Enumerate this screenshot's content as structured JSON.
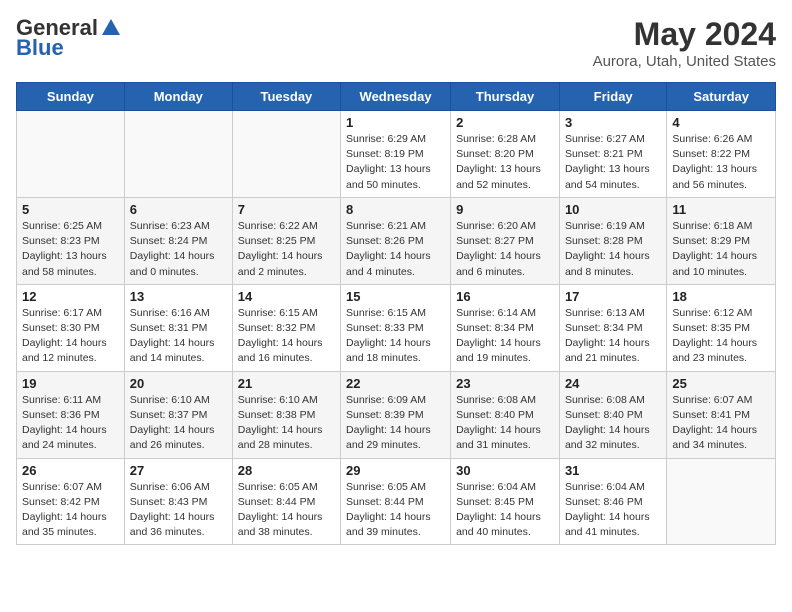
{
  "header": {
    "logo_general": "General",
    "logo_blue": "Blue",
    "month_title": "May 2024",
    "location": "Aurora, Utah, United States"
  },
  "weekdays": [
    "Sunday",
    "Monday",
    "Tuesday",
    "Wednesday",
    "Thursday",
    "Friday",
    "Saturday"
  ],
  "weeks": [
    [
      {
        "day": "",
        "info": ""
      },
      {
        "day": "",
        "info": ""
      },
      {
        "day": "",
        "info": ""
      },
      {
        "day": "1",
        "info": "Sunrise: 6:29 AM\nSunset: 8:19 PM\nDaylight: 13 hours\nand 50 minutes."
      },
      {
        "day": "2",
        "info": "Sunrise: 6:28 AM\nSunset: 8:20 PM\nDaylight: 13 hours\nand 52 minutes."
      },
      {
        "day": "3",
        "info": "Sunrise: 6:27 AM\nSunset: 8:21 PM\nDaylight: 13 hours\nand 54 minutes."
      },
      {
        "day": "4",
        "info": "Sunrise: 6:26 AM\nSunset: 8:22 PM\nDaylight: 13 hours\nand 56 minutes."
      }
    ],
    [
      {
        "day": "5",
        "info": "Sunrise: 6:25 AM\nSunset: 8:23 PM\nDaylight: 13 hours\nand 58 minutes."
      },
      {
        "day": "6",
        "info": "Sunrise: 6:23 AM\nSunset: 8:24 PM\nDaylight: 14 hours\nand 0 minutes."
      },
      {
        "day": "7",
        "info": "Sunrise: 6:22 AM\nSunset: 8:25 PM\nDaylight: 14 hours\nand 2 minutes."
      },
      {
        "day": "8",
        "info": "Sunrise: 6:21 AM\nSunset: 8:26 PM\nDaylight: 14 hours\nand 4 minutes."
      },
      {
        "day": "9",
        "info": "Sunrise: 6:20 AM\nSunset: 8:27 PM\nDaylight: 14 hours\nand 6 minutes."
      },
      {
        "day": "10",
        "info": "Sunrise: 6:19 AM\nSunset: 8:28 PM\nDaylight: 14 hours\nand 8 minutes."
      },
      {
        "day": "11",
        "info": "Sunrise: 6:18 AM\nSunset: 8:29 PM\nDaylight: 14 hours\nand 10 minutes."
      }
    ],
    [
      {
        "day": "12",
        "info": "Sunrise: 6:17 AM\nSunset: 8:30 PM\nDaylight: 14 hours\nand 12 minutes."
      },
      {
        "day": "13",
        "info": "Sunrise: 6:16 AM\nSunset: 8:31 PM\nDaylight: 14 hours\nand 14 minutes."
      },
      {
        "day": "14",
        "info": "Sunrise: 6:15 AM\nSunset: 8:32 PM\nDaylight: 14 hours\nand 16 minutes."
      },
      {
        "day": "15",
        "info": "Sunrise: 6:15 AM\nSunset: 8:33 PM\nDaylight: 14 hours\nand 18 minutes."
      },
      {
        "day": "16",
        "info": "Sunrise: 6:14 AM\nSunset: 8:34 PM\nDaylight: 14 hours\nand 19 minutes."
      },
      {
        "day": "17",
        "info": "Sunrise: 6:13 AM\nSunset: 8:34 PM\nDaylight: 14 hours\nand 21 minutes."
      },
      {
        "day": "18",
        "info": "Sunrise: 6:12 AM\nSunset: 8:35 PM\nDaylight: 14 hours\nand 23 minutes."
      }
    ],
    [
      {
        "day": "19",
        "info": "Sunrise: 6:11 AM\nSunset: 8:36 PM\nDaylight: 14 hours\nand 24 minutes."
      },
      {
        "day": "20",
        "info": "Sunrise: 6:10 AM\nSunset: 8:37 PM\nDaylight: 14 hours\nand 26 minutes."
      },
      {
        "day": "21",
        "info": "Sunrise: 6:10 AM\nSunset: 8:38 PM\nDaylight: 14 hours\nand 28 minutes."
      },
      {
        "day": "22",
        "info": "Sunrise: 6:09 AM\nSunset: 8:39 PM\nDaylight: 14 hours\nand 29 minutes."
      },
      {
        "day": "23",
        "info": "Sunrise: 6:08 AM\nSunset: 8:40 PM\nDaylight: 14 hours\nand 31 minutes."
      },
      {
        "day": "24",
        "info": "Sunrise: 6:08 AM\nSunset: 8:40 PM\nDaylight: 14 hours\nand 32 minutes."
      },
      {
        "day": "25",
        "info": "Sunrise: 6:07 AM\nSunset: 8:41 PM\nDaylight: 14 hours\nand 34 minutes."
      }
    ],
    [
      {
        "day": "26",
        "info": "Sunrise: 6:07 AM\nSunset: 8:42 PM\nDaylight: 14 hours\nand 35 minutes."
      },
      {
        "day": "27",
        "info": "Sunrise: 6:06 AM\nSunset: 8:43 PM\nDaylight: 14 hours\nand 36 minutes."
      },
      {
        "day": "28",
        "info": "Sunrise: 6:05 AM\nSunset: 8:44 PM\nDaylight: 14 hours\nand 38 minutes."
      },
      {
        "day": "29",
        "info": "Sunrise: 6:05 AM\nSunset: 8:44 PM\nDaylight: 14 hours\nand 39 minutes."
      },
      {
        "day": "30",
        "info": "Sunrise: 6:04 AM\nSunset: 8:45 PM\nDaylight: 14 hours\nand 40 minutes."
      },
      {
        "day": "31",
        "info": "Sunrise: 6:04 AM\nSunset: 8:46 PM\nDaylight: 14 hours\nand 41 minutes."
      },
      {
        "day": "",
        "info": ""
      }
    ]
  ]
}
